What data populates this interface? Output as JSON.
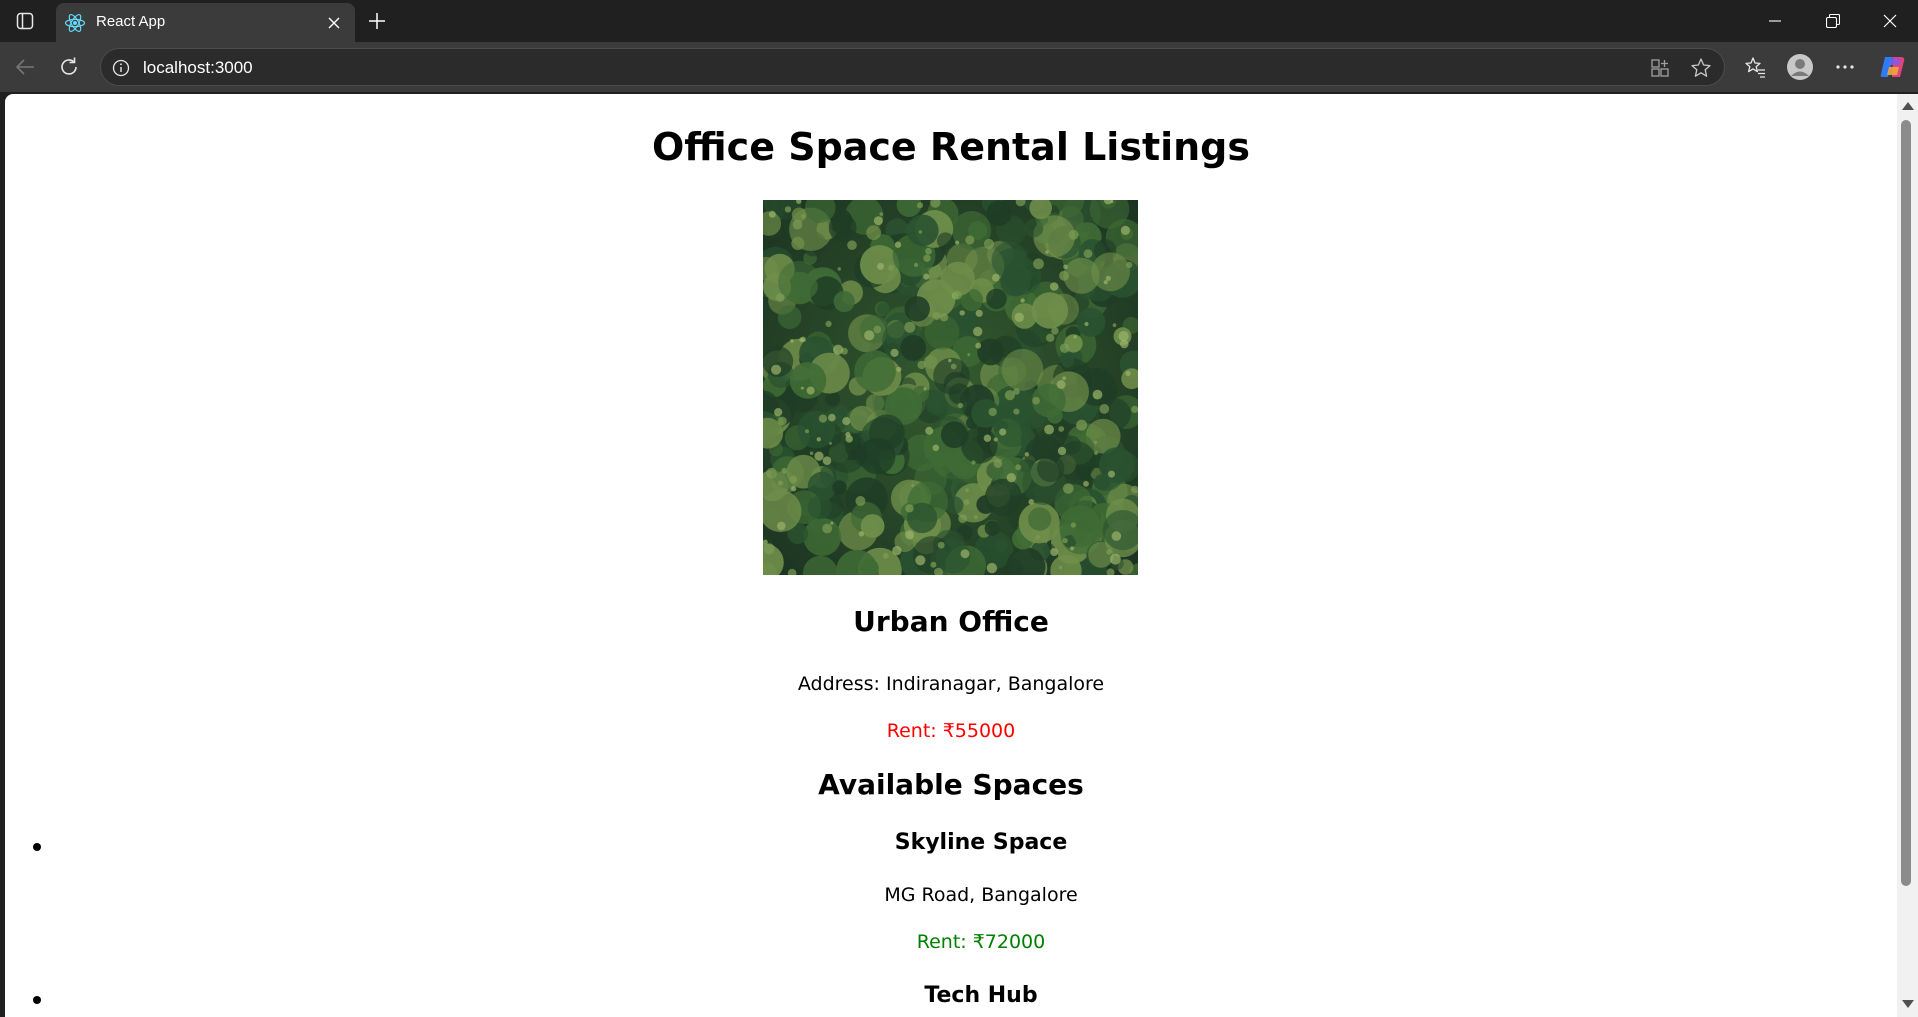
{
  "browser": {
    "tab": {
      "title": "React App",
      "favicon": "react-logo-icon"
    },
    "url": "localhost:3000",
    "colors": {
      "chrome_dark": "#202020",
      "toolbar": "#3b3b3b",
      "omnibox": "#2b2b2b"
    }
  },
  "page": {
    "title": "Office Space Rental Listings",
    "hero_image": {
      "subject": "aerial-forest-photo",
      "colors": [
        "#1f3d26",
        "#3f6b35",
        "#6f8e4a",
        "#2a5230"
      ]
    },
    "featured": {
      "name": "Urban Office",
      "address": "Address: Indiranagar, Bangalore",
      "rent": "Rent: ₹55000",
      "rent_color": "#ff0000"
    },
    "available_title": "Available Spaces",
    "spaces": [
      {
        "name": "Skyline Space",
        "address": "MG Road, Bangalore",
        "rent": "Rent: ₹72000",
        "rent_color": "#008000"
      },
      {
        "name": "Tech Hub",
        "address": "",
        "rent": ""
      }
    ]
  }
}
